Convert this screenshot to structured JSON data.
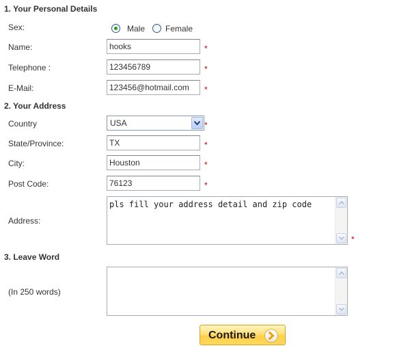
{
  "sections": {
    "personal": "1. Your Personal Details",
    "address": "2. Your Address",
    "leave_word": "3. Leave Word"
  },
  "fields": {
    "sex": {
      "label": "Sex:",
      "options": [
        "Male",
        "Female"
      ],
      "selected": "Male"
    },
    "name": {
      "label": "Name:",
      "value": "hooks"
    },
    "telephone": {
      "label": "Telephone :",
      "value": "123456789"
    },
    "email": {
      "label": "E-Mail:",
      "value": "123456@hotmail.com"
    },
    "country": {
      "label": "Country",
      "value": "USA"
    },
    "state": {
      "label": "State/Province:",
      "value": "TX"
    },
    "city": {
      "label": "City:",
      "value": "Houston"
    },
    "post_code": {
      "label": "Post Code:",
      "value": "76123"
    },
    "address": {
      "label": "Address:",
      "value": "pls fill your address detail and zip code"
    },
    "leave_word": {
      "label": "(In 250 words)",
      "value": ""
    }
  },
  "required_marker": "*",
  "colors": {
    "required": "#d40000",
    "radio_selected": "#21a121",
    "button_gold": "#ffd04a",
    "button_arrow": "#f0a000"
  },
  "buttons": {
    "continue_label": "Continue"
  }
}
